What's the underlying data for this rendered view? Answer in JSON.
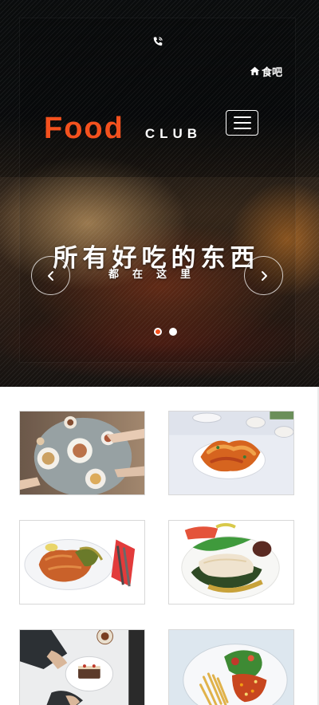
{
  "header": {
    "phone_icon": "phone-icon",
    "home_icon": "home-icon",
    "home_label": "食吧",
    "logo_primary": "Food",
    "logo_secondary": "CLUB",
    "menu_icon": "hamburger-icon",
    "logo_color": "#f4511e"
  },
  "carousel": {
    "title": "所有好吃的东西",
    "subtitle": "都在这里",
    "prev_icon": "chevron-left-icon",
    "next_icon": "chevron-right-icon",
    "slide_count": 2,
    "active_slide": 1,
    "active_dot_color": "#f4511e"
  },
  "gallery": {
    "items": [
      {
        "name": "table-dining-photo"
      },
      {
        "name": "fried-shrimp-photo"
      },
      {
        "name": "schnitzel-plate-photo"
      },
      {
        "name": "fish-fillet-photo"
      },
      {
        "name": "dessert-plate-photo"
      },
      {
        "name": "fries-salad-photo"
      }
    ]
  }
}
